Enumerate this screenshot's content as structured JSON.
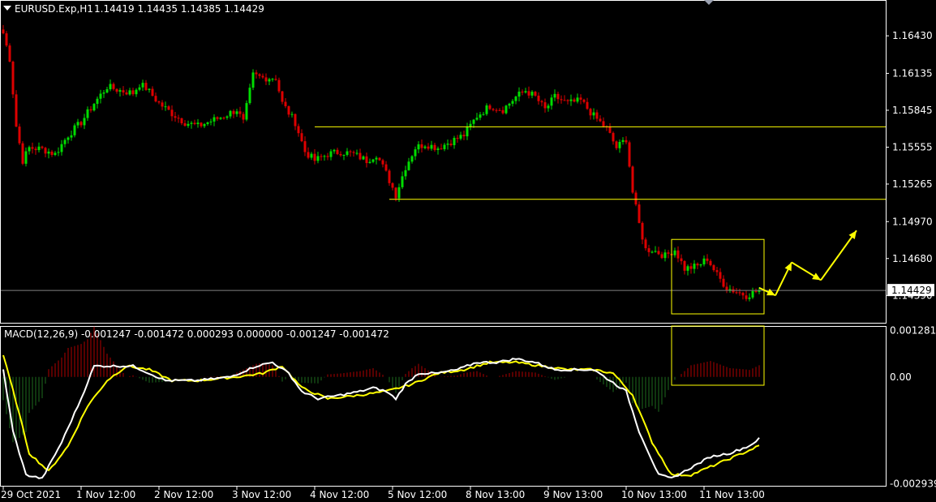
{
  "header": {
    "symbol_label": "EURUSD.Exp,H1",
    "ohlc": "1.14419 1.14435 1.14385 1.14429"
  },
  "macd_header": "MACD(12,26,9) -0.001247 -0.001472 0.000293 0.000000 -0.001247 -0.001472",
  "icons": {
    "menu": "triangle-down-icon",
    "scroll": "triangle-marker-icon"
  },
  "colors": {
    "background": "#000000",
    "bull_candle": "#00dd00",
    "bear_candle": "#dd0000",
    "annotation": "#ffff00",
    "grid_frame": "#ffffff",
    "macd_main": "#ffffff",
    "macd_signal": "#ffff00",
    "hist_positive": "#b00000",
    "hist_negative": "#1e6b1e",
    "price_line": "#808080"
  },
  "chart_data": [
    {
      "type": "candlestick",
      "title": "EURUSD.Exp,H1",
      "ylim": [
        1.14175,
        1.16705
      ],
      "y_ticks": [
        "1.16430",
        "1.16135",
        "1.15845",
        "1.15555",
        "1.15265",
        "1.14970",
        "1.14680",
        "1.14390"
      ],
      "current_price": "1.14429",
      "x_labels": [
        "29 Oct 2021",
        "1 Nov 12:00",
        "2 Nov 12:00",
        "3 Nov 12:00",
        "4 Nov 12:00",
        "5 Nov 12:00",
        "8 Nov 13:00",
        "9 Nov 13:00",
        "10 Nov 13:00",
        "11 Nov 13:00"
      ],
      "anchors": [
        [
          0,
          1.1645
        ],
        [
          2,
          1.1625
        ],
        [
          4,
          1.1572
        ],
        [
          6,
          1.1545
        ],
        [
          8,
          1.1555
        ],
        [
          12,
          1.1554
        ],
        [
          16,
          1.155
        ],
        [
          20,
          1.1565
        ],
        [
          24,
          1.1575
        ],
        [
          28,
          1.159
        ],
        [
          32,
          1.1603
        ],
        [
          36,
          1.16
        ],
        [
          40,
          1.1598
        ],
        [
          42,
          1.1605
        ],
        [
          44,
          1.1602
        ],
        [
          48,
          1.159
        ],
        [
          52,
          1.1582
        ],
        [
          56,
          1.1575
        ],
        [
          60,
          1.1572
        ],
        [
          64,
          1.1576
        ],
        [
          68,
          1.158
        ],
        [
          72,
          1.1585
        ],
        [
          74,
          1.1575
        ],
        [
          77,
          1.1612
        ],
        [
          80,
          1.161
        ],
        [
          84,
          1.161
        ],
        [
          86,
          1.159
        ],
        [
          90,
          1.1575
        ],
        [
          93,
          1.1552
        ],
        [
          96,
          1.1545
        ],
        [
          100,
          1.155
        ],
        [
          104,
          1.1552
        ],
        [
          108,
          1.155
        ],
        [
          112,
          1.1545
        ],
        [
          115,
          1.155
        ],
        [
          118,
          1.1535
        ],
        [
          121,
          1.1518
        ],
        [
          124,
          1.154
        ],
        [
          127,
          1.1555
        ],
        [
          130,
          1.1558
        ],
        [
          134,
          1.1555
        ],
        [
          138,
          1.156
        ],
        [
          142,
          1.1565
        ],
        [
          146,
          1.158
        ],
        [
          150,
          1.1588
        ],
        [
          154,
          1.1585
        ],
        [
          158,
          1.1595
        ],
        [
          161,
          1.16
        ],
        [
          164,
          1.1595
        ],
        [
          167,
          1.1585
        ],
        [
          170,
          1.1595
        ],
        [
          174,
          1.159
        ],
        [
          178,
          1.1592
        ],
        [
          182,
          1.158
        ],
        [
          186,
          1.157
        ],
        [
          189,
          1.1555
        ],
        [
          192,
          1.1562
        ],
        [
          194,
          1.152
        ],
        [
          196,
          1.1495
        ],
        [
          198,
          1.1475
        ],
        [
          200,
          1.1475
        ],
        [
          204,
          1.147
        ],
        [
          207,
          1.1475
        ],
        [
          210,
          1.146
        ],
        [
          214,
          1.1462
        ],
        [
          217,
          1.1468
        ],
        [
          220,
          1.1455
        ],
        [
          223,
          1.1445
        ],
        [
          226,
          1.1442
        ],
        [
          229,
          1.1439
        ],
        [
          233,
          1.1443
        ]
      ],
      "annotations": {
        "resistance_level": 1.15715,
        "support_level": 1.15145,
        "forecast_path": [
          [
            233,
            1.1445
          ],
          [
            238,
            1.1439
          ],
          [
            243,
            1.1465
          ],
          [
            252,
            1.1451
          ],
          [
            263,
            1.149
          ]
        ]
      }
    },
    {
      "type": "macd",
      "title": "MACD(12,26,9)",
      "ylim": [
        -0.003,
        0.00138
      ],
      "y_ticks": [
        "0.001281",
        "0.00",
        "-0.002939"
      ],
      "main_anchors": [
        [
          0,
          0.0002
        ],
        [
          3,
          -0.0015
        ],
        [
          7,
          -0.0027
        ],
        [
          12,
          -0.0028
        ],
        [
          18,
          -0.0018
        ],
        [
          24,
          -0.0006
        ],
        [
          28,
          0.0003
        ],
        [
          32,
          0.0003
        ],
        [
          40,
          0.0003
        ],
        [
          45,
          0.0001
        ],
        [
          50,
          -0.0001
        ],
        [
          60,
          -0.0001
        ],
        [
          70,
          0.0
        ],
        [
          78,
          0.0003
        ],
        [
          83,
          0.0004
        ],
        [
          88,
          0.0001
        ],
        [
          92,
          -0.0004
        ],
        [
          97,
          -0.0006
        ],
        [
          104,
          -0.0005
        ],
        [
          110,
          -0.0004
        ],
        [
          114,
          -0.0003
        ],
        [
          118,
          -0.0004
        ],
        [
          121,
          -0.0006
        ],
        [
          124,
          -0.0002
        ],
        [
          128,
          0.0001
        ],
        [
          134,
          0.0001
        ],
        [
          140,
          0.0002
        ],
        [
          146,
          0.0004
        ],
        [
          152,
          0.0004
        ],
        [
          158,
          0.0005
        ],
        [
          164,
          0.0004
        ],
        [
          170,
          0.0002
        ],
        [
          176,
          0.0002
        ],
        [
          182,
          0.0002
        ],
        [
          187,
          -0.0001
        ],
        [
          192,
          -0.0004
        ],
        [
          196,
          -0.0015
        ],
        [
          202,
          -0.0027
        ],
        [
          206,
          -0.0028
        ],
        [
          212,
          -0.0025
        ],
        [
          218,
          -0.0022
        ],
        [
          224,
          -0.0021
        ],
        [
          230,
          -0.0019
        ],
        [
          233,
          -0.0017
        ]
      ],
      "signal_anchors": [
        [
          0,
          0.0006
        ],
        [
          4,
          -0.0007
        ],
        [
          8,
          -0.0021
        ],
        [
          14,
          -0.0026
        ],
        [
          20,
          -0.0019
        ],
        [
          26,
          -0.0008
        ],
        [
          32,
          -0.0001
        ],
        [
          38,
          0.0003
        ],
        [
          45,
          0.0002
        ],
        [
          52,
          -0.0001
        ],
        [
          60,
          -0.0001
        ],
        [
          72,
          0.0
        ],
        [
          80,
          0.0001
        ],
        [
          86,
          0.0003
        ],
        [
          92,
          -0.0003
        ],
        [
          100,
          -0.0006
        ],
        [
          110,
          -0.0005
        ],
        [
          118,
          -0.0004
        ],
        [
          126,
          -0.0002
        ],
        [
          134,
          0.0001
        ],
        [
          142,
          0.0002
        ],
        [
          150,
          0.0004
        ],
        [
          158,
          0.0004
        ],
        [
          166,
          0.0003
        ],
        [
          174,
          0.0002
        ],
        [
          182,
          0.0002
        ],
        [
          188,
          0.0001
        ],
        [
          194,
          -0.0005
        ],
        [
          200,
          -0.0018
        ],
        [
          206,
          -0.0027
        ],
        [
          212,
          -0.0027
        ],
        [
          220,
          -0.0024
        ],
        [
          228,
          -0.0021
        ],
        [
          233,
          -0.0019
        ]
      ]
    }
  ]
}
